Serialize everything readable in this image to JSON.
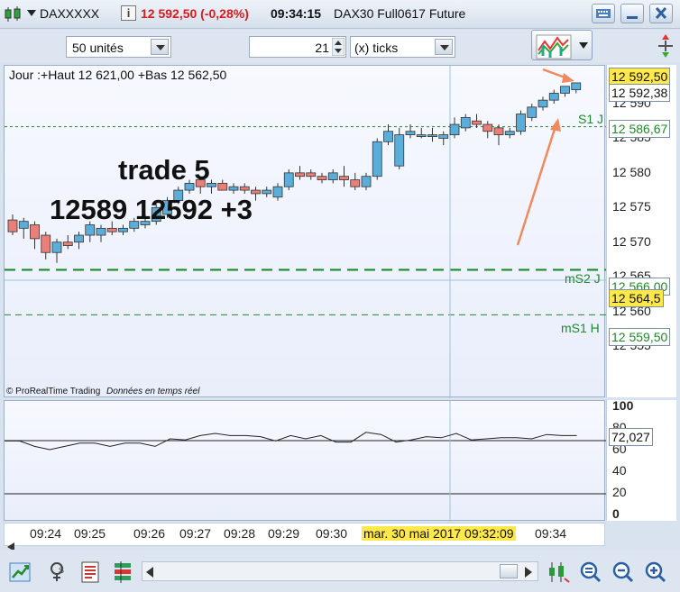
{
  "title_bar": {
    "symbol": "DAXXXXX",
    "info": "i",
    "price_change": "12 592,50 (-0,28%)",
    "time": "09:34:15",
    "instrument": "DAX30 Full0617 Future"
  },
  "toolbar": {
    "units_select": "50 unités",
    "ticks_value": "21",
    "ticks_unit_select": "(x) ticks"
  },
  "chart": {
    "header": "Jour :+Haut 12 621,00 +Bas 12 562,50",
    "annotation_line1": "trade 5",
    "annotation_line2": "12589 12592 +3",
    "watermark": "© ProRealTime Trading",
    "watermark_sub": "Données en temps réel",
    "price_ticks": [
      "12 590",
      "12 585",
      "12 580",
      "12 575",
      "12 570",
      "12 565",
      "12 560",
      "12 555"
    ],
    "tags": {
      "last": "12 592,50",
      "bid": "12 592,38",
      "s1j": "12 586,67",
      "ms2j": "12 566,00",
      "crosshair": "12 564,5",
      "ms1h": "12 559,50"
    },
    "levels": {
      "s1j": "S1 J",
      "ms2j": "mS2 J",
      "ms1h": "mS1 H"
    },
    "colors": {
      "up": "#5aaed9",
      "down": "#e88079",
      "level": "#1d8a2c",
      "tag_yellow": "#ffe94a",
      "arrow": "#f08a5d"
    }
  },
  "indicator": {
    "ticks": [
      "100",
      "80",
      "60",
      "40",
      "20",
      "0"
    ],
    "value": "72,027"
  },
  "time_axis": {
    "labels": [
      "09:24",
      "09:25",
      "09:26",
      "09:27",
      "09:28",
      "09:29",
      "09:30",
      "09:34"
    ],
    "crosshair_label": "mar. 30 mai 2017 09:32:09"
  },
  "chart_data": {
    "type": "candlestick",
    "candles": [
      {
        "o": 12573.2,
        "h": 12574,
        "l": 12571,
        "c": 12571.5
      },
      {
        "o": 12572,
        "h": 12573.5,
        "l": 12570.5,
        "c": 12573
      },
      {
        "o": 12572.5,
        "h": 12573,
        "l": 12569,
        "c": 12570.5
      },
      {
        "o": 12571,
        "h": 12571.5,
        "l": 12567.5,
        "c": 12568.5
      },
      {
        "o": 12568.5,
        "h": 12570.5,
        "l": 12567,
        "c": 12570
      },
      {
        "o": 12570,
        "h": 12571,
        "l": 12569,
        "c": 12569.5
      },
      {
        "o": 12570,
        "h": 12571.5,
        "l": 12569,
        "c": 12571
      },
      {
        "o": 12571,
        "h": 12573,
        "l": 12570,
        "c": 12572.5
      },
      {
        "o": 12571,
        "h": 12572.5,
        "l": 12570,
        "c": 12572
      },
      {
        "o": 12572,
        "h": 12573,
        "l": 12571,
        "c": 12571.5
      },
      {
        "o": 12571.5,
        "h": 12572.5,
        "l": 12571,
        "c": 12572
      },
      {
        "o": 12572,
        "h": 12573.5,
        "l": 12571.5,
        "c": 12573
      },
      {
        "o": 12572.5,
        "h": 12574,
        "l": 12572,
        "c": 12573
      },
      {
        "o": 12573,
        "h": 12575.5,
        "l": 12572.5,
        "c": 12575
      },
      {
        "o": 12574,
        "h": 12576.5,
        "l": 12573.5,
        "c": 12576
      },
      {
        "o": 12576,
        "h": 12578,
        "l": 12575.5,
        "c": 12577.5
      },
      {
        "o": 12577.5,
        "h": 12579,
        "l": 12577,
        "c": 12578.5
      },
      {
        "o": 12579,
        "h": 12579.5,
        "l": 12577,
        "c": 12578
      },
      {
        "o": 12578,
        "h": 12579,
        "l": 12577,
        "c": 12578.5
      },
      {
        "o": 12578.5,
        "h": 12579,
        "l": 12577.5,
        "c": 12577.5
      },
      {
        "o": 12577.5,
        "h": 12578.5,
        "l": 12577,
        "c": 12578
      },
      {
        "o": 12578,
        "h": 12578.5,
        "l": 12577,
        "c": 12577.5
      },
      {
        "o": 12577.5,
        "h": 12578,
        "l": 12576,
        "c": 12577
      },
      {
        "o": 12577,
        "h": 12578,
        "l": 12576.5,
        "c": 12577.5
      },
      {
        "o": 12576.5,
        "h": 12578.5,
        "l": 12576,
        "c": 12578
      },
      {
        "o": 12578,
        "h": 12580.5,
        "l": 12577.5,
        "c": 12580
      },
      {
        "o": 12580,
        "h": 12581,
        "l": 12579,
        "c": 12579.5
      },
      {
        "o": 12580,
        "h": 12580.5,
        "l": 12579,
        "c": 12579.5
      },
      {
        "o": 12579.5,
        "h": 12580,
        "l": 12578.5,
        "c": 12579
      },
      {
        "o": 12579,
        "h": 12580.5,
        "l": 12578.5,
        "c": 12580
      },
      {
        "o": 12579.5,
        "h": 12581,
        "l": 12578,
        "c": 12579
      },
      {
        "o": 12579,
        "h": 12580,
        "l": 12577.5,
        "c": 12578
      },
      {
        "o": 12578,
        "h": 12580,
        "l": 12577.5,
        "c": 12579.5
      },
      {
        "o": 12579.5,
        "h": 12585,
        "l": 12579,
        "c": 12584.5
      },
      {
        "o": 12584.5,
        "h": 12587,
        "l": 12584,
        "c": 12586
      },
      {
        "o": 12581,
        "h": 12586.5,
        "l": 12580.5,
        "c": 12585.5
      },
      {
        "o": 12585.5,
        "h": 12587,
        "l": 12585,
        "c": 12586
      },
      {
        "o": 12585.5,
        "h": 12586.5,
        "l": 12585,
        "c": 12585.5
      },
      {
        "o": 12585.5,
        "h": 12586.5,
        "l": 12584.5,
        "c": 12585.5
      },
      {
        "o": 12585,
        "h": 12586,
        "l": 12584,
        "c": 12585.5
      },
      {
        "o": 12585.5,
        "h": 12588,
        "l": 12585,
        "c": 12587
      },
      {
        "o": 12586.5,
        "h": 12588.5,
        "l": 12586,
        "c": 12588
      },
      {
        "o": 12587.5,
        "h": 12588.5,
        "l": 12586.5,
        "c": 12587
      },
      {
        "o": 12587,
        "h": 12587.5,
        "l": 12585,
        "c": 12586
      },
      {
        "o": 12586.5,
        "h": 12587,
        "l": 12584,
        "c": 12585.5
      },
      {
        "o": 12585.5,
        "h": 12586.5,
        "l": 12585,
        "c": 12586
      },
      {
        "o": 12586,
        "h": 12589,
        "l": 12585.5,
        "c": 12588.5
      },
      {
        "o": 12588,
        "h": 12590,
        "l": 12587.5,
        "c": 12589.5
      },
      {
        "o": 12589.5,
        "h": 12591,
        "l": 12589,
        "c": 12590.5
      },
      {
        "o": 12590.5,
        "h": 12592,
        "l": 12590,
        "c": 12591.5
      },
      {
        "o": 12591.5,
        "h": 12592.5,
        "l": 12591,
        "c": 12592.5
      },
      {
        "o": 12592,
        "h": 12593,
        "l": 12591.5,
        "c": 12593
      }
    ],
    "indicator": [
      68,
      68,
      63,
      60,
      63,
      66,
      66,
      63,
      66,
      66,
      63,
      70,
      69,
      73,
      75,
      73,
      73,
      72,
      68,
      73,
      70,
      73,
      67,
      67,
      76,
      74,
      67,
      69,
      72,
      71,
      75,
      69,
      70,
      71,
      71,
      70,
      74,
      73,
      73
    ],
    "ylim": [
      12553,
      12593
    ],
    "indicator_ylim": [
      0,
      100
    ]
  }
}
